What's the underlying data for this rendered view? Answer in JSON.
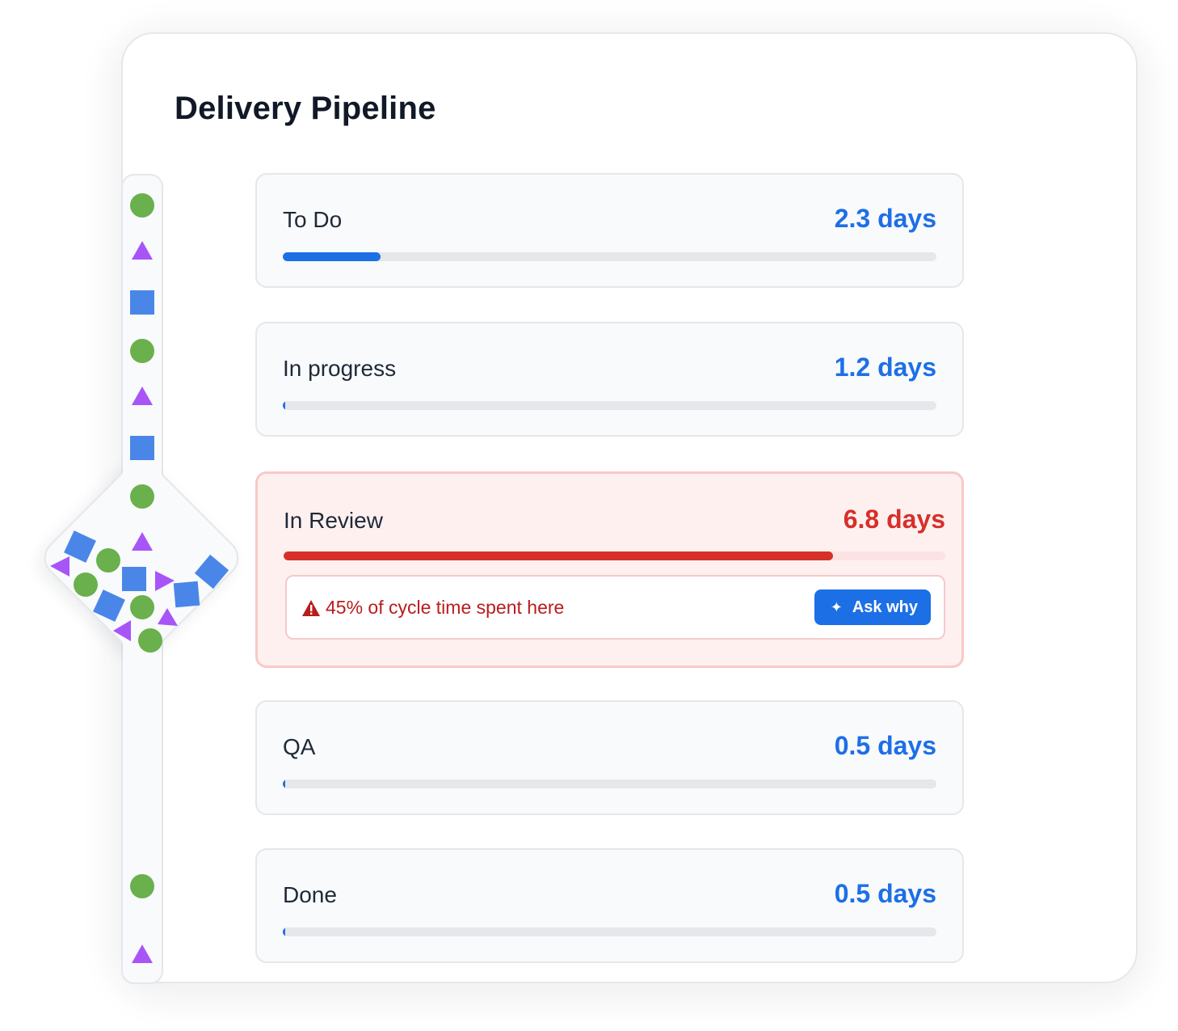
{
  "title": "Delivery Pipeline",
  "colors": {
    "accent": "#1d6fe6",
    "alert": "#d6302a",
    "shape_circle": "#6ab04c",
    "shape_triangle": "#a855f7",
    "shape_square": "#4a86e8"
  },
  "stages": [
    {
      "label": "To Do",
      "value": "2.3 days",
      "progress_percent": 15,
      "status": "normal"
    },
    {
      "label": "In progress",
      "value": "1.2 days",
      "progress_percent": 0,
      "status": "normal"
    },
    {
      "label": "In Review",
      "value": "6.8 days",
      "progress_percent": 83,
      "status": "alert"
    },
    {
      "label": "QA",
      "value": "0.5 days",
      "progress_percent": 0,
      "status": "normal"
    },
    {
      "label": "Done",
      "value": "0.5 days",
      "progress_percent": 0,
      "status": "normal"
    }
  ],
  "alert": {
    "icon": "warning-icon",
    "message": "45% of cycle time spent here",
    "button_icon": "sparkle-icon",
    "button_label": "Ask why"
  },
  "flow_track": {
    "item_shapes": [
      "circle",
      "triangle",
      "square",
      "circle",
      "triangle",
      "square",
      "circle",
      "circle",
      "triangle"
    ],
    "bottleneck_shapes": [
      "square",
      "circle",
      "triangle",
      "circle",
      "square",
      "triangle",
      "square",
      "square",
      "circle",
      "triangle",
      "triangle",
      "circle",
      "square",
      "circle",
      "triangle"
    ]
  }
}
